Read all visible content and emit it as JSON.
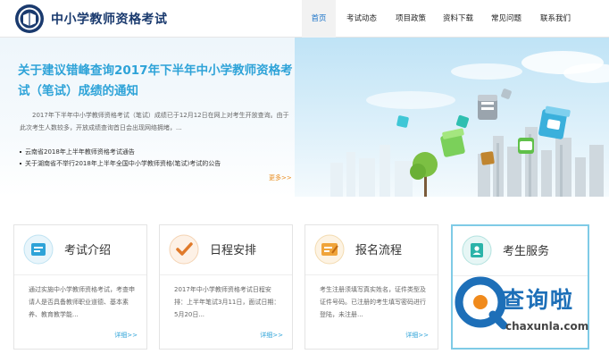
{
  "header": {
    "site_title": "中小学教师资格考试",
    "nav": [
      {
        "label": "首页",
        "active": true
      },
      {
        "label": "考试动态",
        "active": false
      },
      {
        "label": "项目政策",
        "active": false
      },
      {
        "label": "资料下载",
        "active": false
      },
      {
        "label": "常见问题",
        "active": false
      },
      {
        "label": "联系我们",
        "active": false
      }
    ]
  },
  "hero": {
    "title": "关于建议错峰查询2017年下半年中小学教师资格考试（笔试）成绩的通知",
    "summary": "2017年下半年中小学教师资格考试（笔试）成绩已于12月12日在网上对考生开放查询。由于此次考生人数较多，开放成绩查询首日会出现网络拥堵，...",
    "links": [
      "云南省2018年上半年教师资格考试通告",
      "关于湖南省不举行2018年上半年全国中小学教师资格(笔试)考试的公告"
    ],
    "more": "更多>>"
  },
  "cards": [
    {
      "title": "考试介绍",
      "text": "通过实施中小学教师资格考试，考查申请人是否具备教师职业道德、基本素养、教育教学能...",
      "more": "详细>>",
      "icon": "exam-intro-icon"
    },
    {
      "title": "日程安排",
      "text": "2017年中小学教师资格考试日程安排：上半年笔试3月11日，面试日期：5月20日...",
      "more": "详细>>",
      "icon": "schedule-check-icon"
    },
    {
      "title": "报名流程",
      "text": "考生注册须填写真实姓名，证件类型及证件号码。已注册的考生填写密码进行登陆，未注册...",
      "more": "详细>>",
      "icon": "registration-form-icon"
    },
    {
      "title": "考生服务",
      "text": "",
      "more": "",
      "icon": "candidate-service-icon"
    }
  ],
  "watermark": {
    "brand": "查询啦",
    "domain": "chaxunla.com"
  },
  "colors": {
    "accent": "#2ea3d8",
    "title_navy": "#1a3a6e",
    "more_orange": "#e88a1a",
    "watermark_blue": "#1d6fb8"
  }
}
